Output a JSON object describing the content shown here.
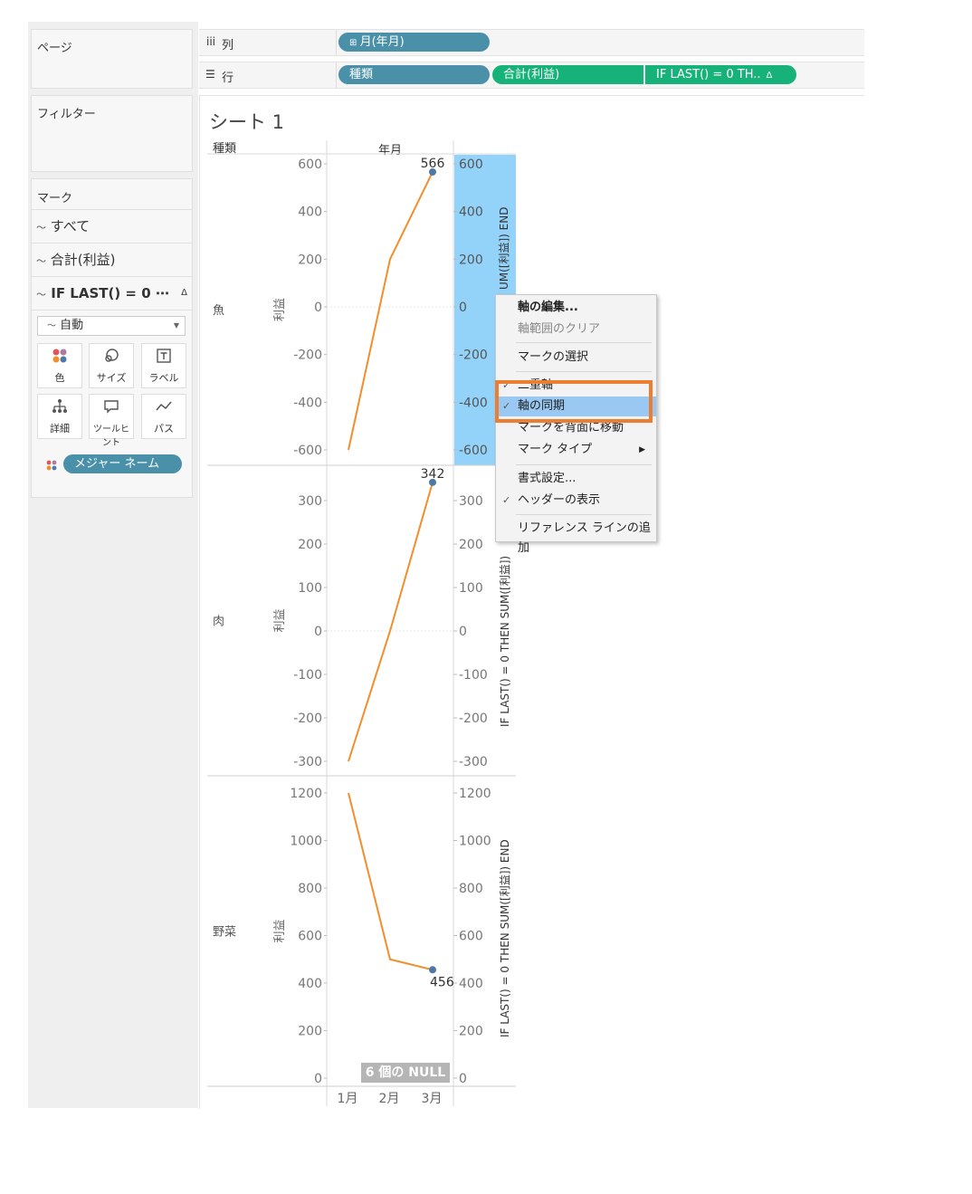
{
  "left_panel": {
    "pages_title": "ページ",
    "filters_title": "フィルター",
    "marks_title": "マーク",
    "mark_rows": [
      "すべて",
      "合計(利益)",
      "IF LAST() = 0 ⋯"
    ],
    "mark_type_select": "自動",
    "mark_buttons": [
      {
        "label": "色",
        "icon": "color-icon"
      },
      {
        "label": "サイズ",
        "icon": "size-icon"
      },
      {
        "label": "ラベル",
        "icon": "label-icon"
      },
      {
        "label": "詳細",
        "icon": "detail-icon"
      },
      {
        "label": "ツールヒント",
        "icon": "tooltip-icon"
      },
      {
        "label": "パス",
        "icon": "path-icon"
      }
    ],
    "measure_names_pill": "メジャー ネーム"
  },
  "shelves": {
    "columns_label": "列",
    "rows_label": "行",
    "columns_pills": [
      "月(年月)"
    ],
    "rows_pills": [
      "種類",
      "合計(利益)",
      "IF LAST() = 0 TH.."
    ],
    "colors": {
      "blue": "#4a90a8",
      "green": "#17b279"
    }
  },
  "sheet": {
    "title": "シート 1",
    "row_header": "種類",
    "col_header": "年月",
    "axis_label": "利益",
    "dual_axis_label_top": "UM([利益]) END",
    "dual_axis_label_mid": "IF LAST() = 0 THEN SUM([利益])",
    "dual_axis_label_bottom": "IF LAST() = 0 THEN SUM([利益]) END",
    "x_ticks": [
      "1月",
      "2月",
      "3月"
    ],
    "null_badge": "6 個の NULL"
  },
  "chart_data": [
    {
      "type": "line",
      "category": "魚",
      "x": [
        "1月",
        "2月",
        "3月"
      ],
      "values": [
        -600,
        200,
        566
      ],
      "last_label": "566",
      "ylim": [
        -600,
        600
      ],
      "ticks": [
        "600",
        "400",
        "200",
        "0",
        "-200",
        "-400",
        "-600"
      ],
      "right_ticks": [
        "600",
        "400",
        "200",
        "0",
        "-200",
        "-400",
        "-600"
      ]
    },
    {
      "type": "line",
      "category": "肉",
      "x": [
        "1月",
        "2月",
        "3月"
      ],
      "values": [
        -300,
        0,
        342
      ],
      "last_label": "342",
      "ylim": [
        -300,
        300
      ],
      "ticks": [
        "300",
        "200",
        "100",
        "0",
        "-100",
        "-200",
        "-300"
      ],
      "right_ticks": [
        "300",
        "200",
        "100",
        "0",
        "-100",
        "-200",
        "-300"
      ]
    },
    {
      "type": "line",
      "category": "野菜",
      "x": [
        "1月",
        "2月",
        "3月"
      ],
      "values": [
        1200,
        500,
        456
      ],
      "last_label": "456",
      "ylim": [
        0,
        1200
      ],
      "ticks": [
        "1200",
        "1000",
        "800",
        "600",
        "400",
        "200",
        "0"
      ],
      "right_ticks": [
        "1200",
        "1000",
        "800",
        "600",
        "400",
        "200",
        "0"
      ]
    }
  ],
  "context_menu": {
    "items": [
      {
        "label": "軸の編集...",
        "bold": true
      },
      {
        "label": "軸範囲のクリア",
        "disabled": true
      },
      {
        "label": "マークの選択"
      },
      {
        "label": "二重軸",
        "checked": true
      },
      {
        "label": "軸の同期",
        "checked": true,
        "highlighted": true
      },
      {
        "label": "マークを背面に移動"
      },
      {
        "label": "マーク タイプ",
        "submenu": true
      },
      {
        "label": "書式設定..."
      },
      {
        "label": "ヘッダーの表示",
        "checked": true
      },
      {
        "label": "リファレンス ラインの追加"
      }
    ],
    "highlight_color": "#ed7d31"
  }
}
